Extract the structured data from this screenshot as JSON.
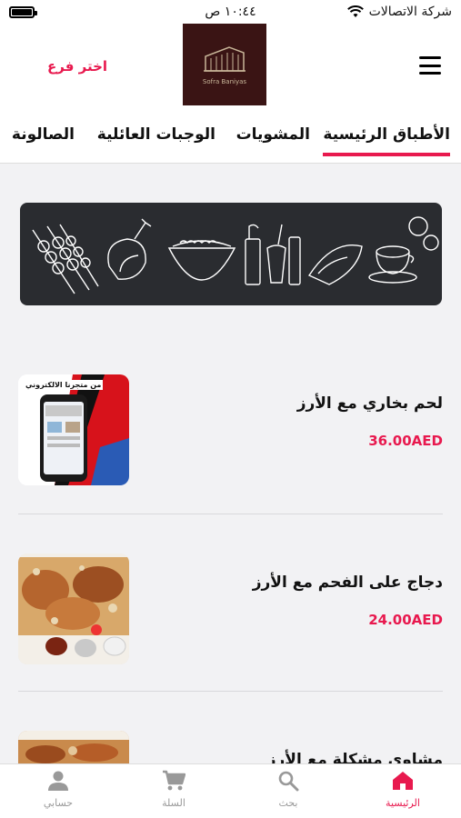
{
  "status_bar": {
    "carrier": "شركة الاتصالات",
    "time": "١٠:٤٤ ص"
  },
  "header": {
    "branch_button": "اختر فرع",
    "logo_text": "Sofra Baniyas"
  },
  "tabs": [
    {
      "label": "الأطباق الرئيسية",
      "active": true
    },
    {
      "label": "المشويات",
      "active": false
    },
    {
      "label": "الوجبات العائلية",
      "active": false
    },
    {
      "label": "الصالونة",
      "active": false
    }
  ],
  "products": [
    {
      "name": "لحم بخاري مع الأرز",
      "price": "36.00AED",
      "thumb_caption": "من متجرنا الالكتروني"
    },
    {
      "name": "دجاج على الفحم مع الأرز",
      "price": "24.00AED"
    },
    {
      "name": "مشاوي مشكلة مع الأرز",
      "price": ""
    }
  ],
  "bottom_nav": [
    {
      "label": "الرئيسية",
      "icon": "home-icon",
      "active": true
    },
    {
      "label": "بحث",
      "icon": "search-icon",
      "active": false
    },
    {
      "label": "السلة",
      "icon": "cart-icon",
      "active": false
    },
    {
      "label": "حسابي",
      "icon": "account-icon",
      "active": false
    }
  ],
  "colors": {
    "accent": "#e8194e",
    "banner_bg": "#2a2c30",
    "logo_bg": "#3a1414"
  }
}
